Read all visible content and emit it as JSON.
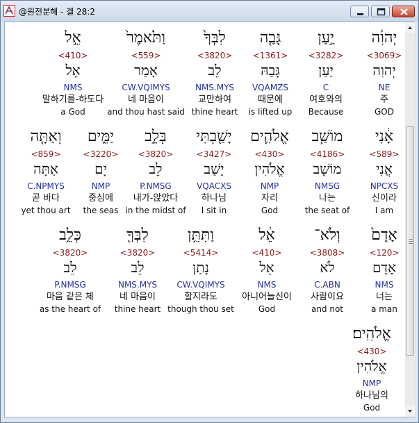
{
  "window": {
    "title": "@원전분해 - 겔 28:2"
  },
  "rows": [
    [
      {
        "heb": "יְהוִ֔ה",
        "strong": "<3069>",
        "lemma": "יְהוִה",
        "morph": "NE",
        "kor": "주",
        "eng": "GOD"
      },
      {
        "heb": "יַ֣עַן",
        "strong": "<3282>",
        "lemma": "יַעַן",
        "morph": "C",
        "kor": "여호와의",
        "eng": "Because"
      },
      {
        "heb": "גָּבַ֤ה",
        "strong": "<1361>",
        "lemma": "גָּבַהּ",
        "morph": "VQAMZS",
        "kor": "때문에",
        "eng": "is lifted up"
      },
      {
        "heb": "לִבְּךָ֙",
        "strong": "<3820>",
        "lemma": "לֵב",
        "morph": "NMS.MYS",
        "kor": "교만하여",
        "eng": "thine heart"
      },
      {
        "heb": "וַתֹּ֙אמֶר֙",
        "strong": "<559>",
        "lemma": "אָמַר",
        "morph": "CW.VQIMYS",
        "kor": "네 마음이",
        "eng": "and thou hast said"
      },
      {
        "heb": "אֵ֣ל",
        "strong": "<410>",
        "lemma": "אֵל",
        "morph": "NMS",
        "kor": "말하기를-하도다",
        "eng": "a God"
      }
    ],
    [
      {
        "heb": "אָ֔נִי",
        "strong": "<589>",
        "lemma": "אֲנִי",
        "morph": "NPCXS",
        "kor": "신이라",
        "eng": "I am"
      },
      {
        "heb": "מוֹשַׁ֧ב",
        "strong": "<4186>",
        "lemma": "מוֹשָׁב",
        "morph": "NMSG",
        "kor": "나는",
        "eng": "the seat of"
      },
      {
        "heb": "אֱלֹהִ֛ים",
        "strong": "<430>",
        "lemma": "אֱלֹהִין",
        "morph": "NMP",
        "kor": "자리",
        "eng": "God"
      },
      {
        "heb": "יָשַׁ֖בְתִּי",
        "strong": "<3427>",
        "lemma": "יָשַׁב",
        "morph": "VQACXS",
        "kor": "하나님",
        "eng": "I sit in"
      },
      {
        "heb": "בְּלֵ֣ב",
        "strong": "<3820>",
        "lemma": "לֵב",
        "morph": "P.NMSG",
        "kor": "내가-앉았다",
        "eng": "in the midst of"
      },
      {
        "heb": "יַמִּ֑ים",
        "strong": "<3220>",
        "lemma": "יָם",
        "morph": "NMP",
        "kor": "중심에",
        "eng": "the seas"
      },
      {
        "heb": "וְאַתָּ֤ה",
        "strong": "<859>",
        "lemma": "אַתָּה",
        "morph": "C.NPMYS",
        "kor": "곧 바다",
        "eng": "yet thou art"
      }
    ],
    [
      {
        "heb": "אָדָם֙",
        "strong": "<120>",
        "lemma": "אָדָם",
        "morph": "NMS",
        "kor": "너는",
        "eng": "a man"
      },
      {
        "heb": "וְלֹא־",
        "strong": "<3808>",
        "lemma": "לֹא",
        "morph": "C.ABN",
        "kor": "사람이요",
        "eng": "and not"
      },
      {
        "heb": "אֵ֔ל",
        "strong": "<410>",
        "lemma": "אֵל",
        "morph": "NMS",
        "kor": "아니어늘신이",
        "eng": "God"
      },
      {
        "heb": "וַתִּתֵּ֥ן",
        "strong": "<5414>",
        "lemma": "נָתַן",
        "morph": "CW.VQIMYS",
        "kor": "할지라도",
        "eng": "though thou set"
      },
      {
        "heb": "לִבְּךָ֖",
        "strong": "<3820>",
        "lemma": "לֵב",
        "morph": "NMS.MYS",
        "kor": "네 마음이",
        "eng": "thine heart"
      },
      {
        "heb": "כְּלֵ֥ב",
        "strong": "<3820>",
        "lemma": "לֵב",
        "morph": "P.NMSG",
        "kor": "마음 같은 체",
        "eng": "as the heart of"
      }
    ],
    [
      {
        "heb": "אֱלֹהִֽים׃",
        "strong": "<430>",
        "lemma": "אֱלֹהִין",
        "morph": "NMP",
        "kor": "하나님의",
        "eng": "God"
      }
    ]
  ]
}
